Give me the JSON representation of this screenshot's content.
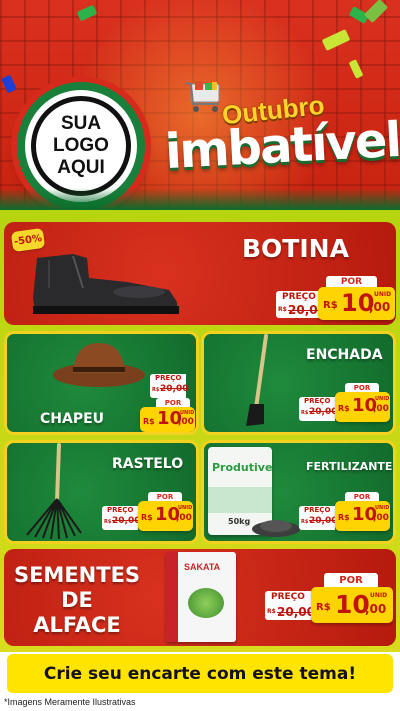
{
  "header": {
    "logo_lines": [
      "SUA",
      "LOGO",
      "AQUI"
    ],
    "theme_line1": "Outubro",
    "theme_line2": "imbatível"
  },
  "products": [
    {
      "title": "BOTINA",
      "discount": "-50%",
      "old_label": "PREÇO",
      "old_currency": "R$",
      "old_value": "20,00",
      "now_label": "POR",
      "currency": "R$",
      "value_int": "10",
      "value_dec": ",00",
      "unit": "UNID"
    },
    {
      "title": "CHAPEU",
      "old_label": "PREÇO",
      "old_currency": "R$",
      "old_value": "20,00",
      "now_label": "POR",
      "currency": "R$",
      "value_int": "10",
      "value_dec": ",00",
      "unit": "UNID"
    },
    {
      "title": "ENCHADA",
      "old_label": "PREÇO",
      "old_currency": "R$",
      "old_value": "20,00",
      "now_label": "POR",
      "currency": "R$",
      "value_int": "10",
      "value_dec": ",00",
      "unit": "UNID"
    },
    {
      "title": "RASTELO",
      "old_label": "PREÇO",
      "old_currency": "R$",
      "old_value": "20,00",
      "now_label": "POR",
      "currency": "R$",
      "value_int": "10",
      "value_dec": ",00",
      "unit": "UNID"
    },
    {
      "title": "FERTILIZANTES",
      "bag_brand": "Produtive",
      "bag_weight": "50kg",
      "old_label": "PREÇO",
      "old_currency": "R$",
      "old_value": "20,00",
      "now_label": "POR",
      "currency": "R$",
      "value_int": "10",
      "value_dec": ",00",
      "unit": "UNID"
    },
    {
      "title_lines": [
        "SEMENTES",
        "DE",
        "ALFACE"
      ],
      "pack_brand": "SAKATA",
      "old_label": "PREÇO",
      "old_currency": "R$",
      "old_value": "20,00",
      "now_label": "POR",
      "currency": "R$",
      "value_int": "10",
      "value_dec": ",00",
      "unit": "UNID"
    }
  ],
  "cta": "Crie seu encarte com este tema!",
  "note": "*Imagens Meramente Ilustrativas",
  "colors": {
    "red": "#d9311f",
    "green": "#1a7f3b",
    "yellow": "#ffd400",
    "price_red": "#c0150a"
  }
}
